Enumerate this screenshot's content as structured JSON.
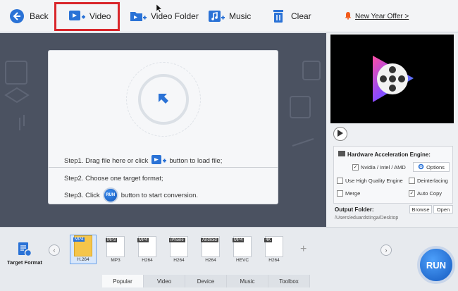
{
  "toolbar": {
    "back": "Back",
    "video": "Video",
    "video_folder": "Video Folder",
    "music": "Music",
    "clear": "Clear",
    "offer": "New Year Offer >"
  },
  "drop_area": {
    "step1_before": "Step1. Drag file here or click",
    "step1_after": "button to load file;",
    "step2": "Step2. Choose one target format;",
    "step3_before": "Step3. Click",
    "step3_after": "button to start conversion.",
    "run_small": "RUN"
  },
  "settings": {
    "hw_title": "Hardware Acceleration Engine:",
    "nvidia": "Nvidia / Intel / AMD",
    "options": "Options",
    "high_quality": "Use High Quality Engine",
    "deinterlacing": "Deinterlacing",
    "merge": "Merge",
    "auto_copy": "Auto Copy",
    "output_label": "Output Folder:",
    "output_path": "/Users/eduardstinga/Desktop",
    "browse": "Browse",
    "open": "Open"
  },
  "formats": {
    "target_format": "Target Format",
    "items": [
      {
        "tag": "MP4",
        "label": "H.264"
      },
      {
        "tag": "MP3",
        "label": "MP3"
      },
      {
        "tag": "MP4",
        "label": "H264"
      },
      {
        "tag": "iPhone",
        "label": "H264"
      },
      {
        "tag": "Android",
        "label": "H264"
      },
      {
        "tag": "MP4",
        "label": "HEVC"
      },
      {
        "tag": "4K",
        "label": "H264"
      }
    ]
  },
  "tabs": [
    "Popular",
    "Video",
    "Device",
    "Music",
    "Toolbox"
  ],
  "run_big": "RUN",
  "colors": {
    "accent": "#2a72d6",
    "highlight": "#d9262b"
  }
}
